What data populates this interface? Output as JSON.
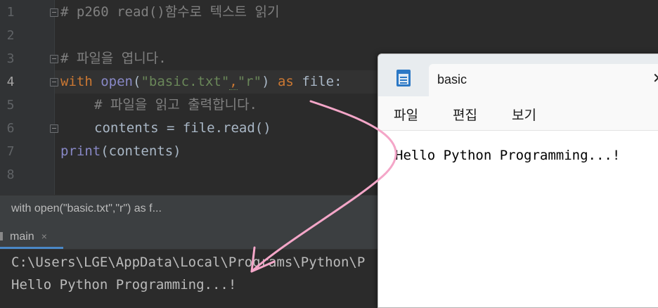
{
  "editor": {
    "line_numbers": [
      "1",
      "2",
      "3",
      "4",
      "5",
      "6",
      "7",
      "8"
    ],
    "lines": {
      "l1_comment": "# p260 read()함수로 텍스트 읽기",
      "l3_comment": "# 파일을 엽니다.",
      "l4_with": "with",
      "l4_open": "open",
      "l4_paren_open": "(",
      "l4_str1": "\"basic.txt\"",
      "l4_comma": ",",
      "l4_str2": "\"r\"",
      "l4_paren_close": ")",
      "l4_as": "as",
      "l4_file": "file:",
      "l5_comment": "# 파일을 읽고 출력합니다.",
      "l6_code": "contents = file.read()",
      "l7_print": "print",
      "l7_args": "(contents)"
    }
  },
  "breadcrumb": {
    "text": "with open(\"basic.txt\",\"r\") as f..."
  },
  "run": {
    "tab_label": "main",
    "close": "×",
    "console_lines": [
      "C:\\Users\\LGE\\AppData\\Local\\Programs\\Python\\P",
      "Hello Python Programming...!"
    ]
  },
  "notepad": {
    "title": "basic",
    "close": "✕",
    "menu": [
      "파일",
      "편집",
      "보기"
    ],
    "content": "Hello Python Programming...!"
  },
  "colors": {
    "editor_bg": "#2b2b2b",
    "keyword": "#cc7832",
    "string": "#6a8759",
    "comment": "#808080",
    "arrow": "#f4a6c8"
  }
}
